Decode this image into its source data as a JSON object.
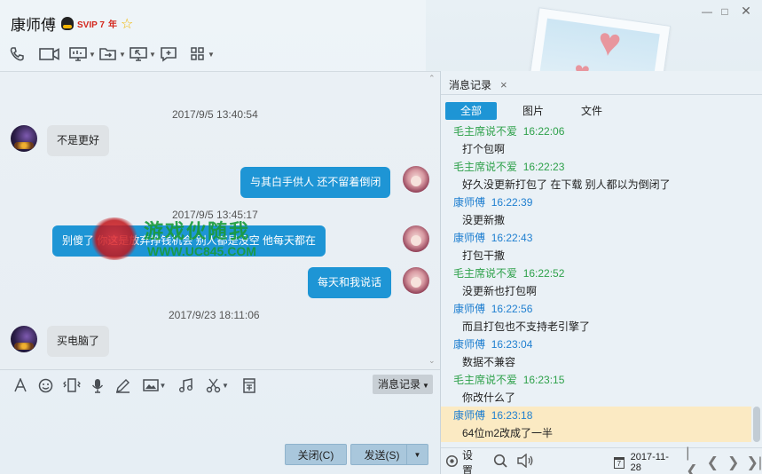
{
  "header": {
    "title": "康师傅",
    "badge": "SVIP 7",
    "badge_suffix": "年"
  },
  "toolbar": {
    "items": [
      "phone-icon",
      "video-icon",
      "screen-share-icon",
      "file-transfer-icon",
      "remote-desktop-icon",
      "add-chat-icon",
      "apps-grid-icon"
    ]
  },
  "chat": {
    "messages": [
      {
        "type": "timestamp",
        "text": "2017/9/5 13:40:54"
      },
      {
        "type": "in",
        "text": "不是更好"
      },
      {
        "type": "out",
        "text": "与其白手供人 还不留着倒闭"
      },
      {
        "type": "timestamp",
        "text": "2017/9/5 13:45:17"
      },
      {
        "type": "out",
        "text": "别傻了 你这是放弃挣钱机会 别人都是没空 他每天都在"
      },
      {
        "type": "out",
        "text": "每天和我说话"
      },
      {
        "type": "timestamp",
        "text": "2017/9/23 18:11:06"
      },
      {
        "type": "in",
        "text": "买电脑了"
      }
    ],
    "watermark_title": "游戏伙随我",
    "watermark_url": "WWW.UC845.COM"
  },
  "input": {
    "history_label": "消息记录",
    "close_label": "关闭(C)",
    "send_label": "发送(S)"
  },
  "history_panel": {
    "tab_label": "消息记录",
    "filters": [
      "全部",
      "图片",
      "文件"
    ],
    "active_filter": "全部",
    "records": [
      {
        "sender": "毛主席说不爱",
        "time": "16:22:06",
        "text": "打个包啊",
        "color": "green"
      },
      {
        "sender": "毛主席说不爱",
        "time": "16:22:23",
        "text": "好久没更新打包了 在下载 别人都以为倒闭了",
        "color": "green"
      },
      {
        "sender": "康师傅",
        "time": "16:22:39",
        "text": "没更新撒",
        "color": "blue"
      },
      {
        "sender": "康师傅",
        "time": "16:22:43",
        "text": "打包干撒",
        "color": "blue"
      },
      {
        "sender": "毛主席说不爱",
        "time": "16:22:52",
        "text": "没更新也打包啊",
        "color": "green"
      },
      {
        "sender": "康师傅",
        "time": "16:22:56",
        "text": "而且打包也不支持老引擎了",
        "color": "blue"
      },
      {
        "sender": "康师傅",
        "time": "16:23:04",
        "text": "数据不兼容",
        "color": "blue"
      },
      {
        "sender": "毛主席说不爱",
        "time": "16:23:15",
        "text": "你改什么了",
        "color": "green"
      },
      {
        "sender": "康师傅",
        "time": "16:23:18",
        "text": "64位m2改成了一半",
        "color": "blue",
        "highlight": true
      }
    ],
    "settings_label": "设置",
    "date": "2017-11-28",
    "calendar_day": "7"
  },
  "colors": {
    "accent": "#1e95d5",
    "green_sender": "#2ea14a",
    "blue_sender": "#1f7fd0",
    "highlight": "#fbeac3"
  }
}
